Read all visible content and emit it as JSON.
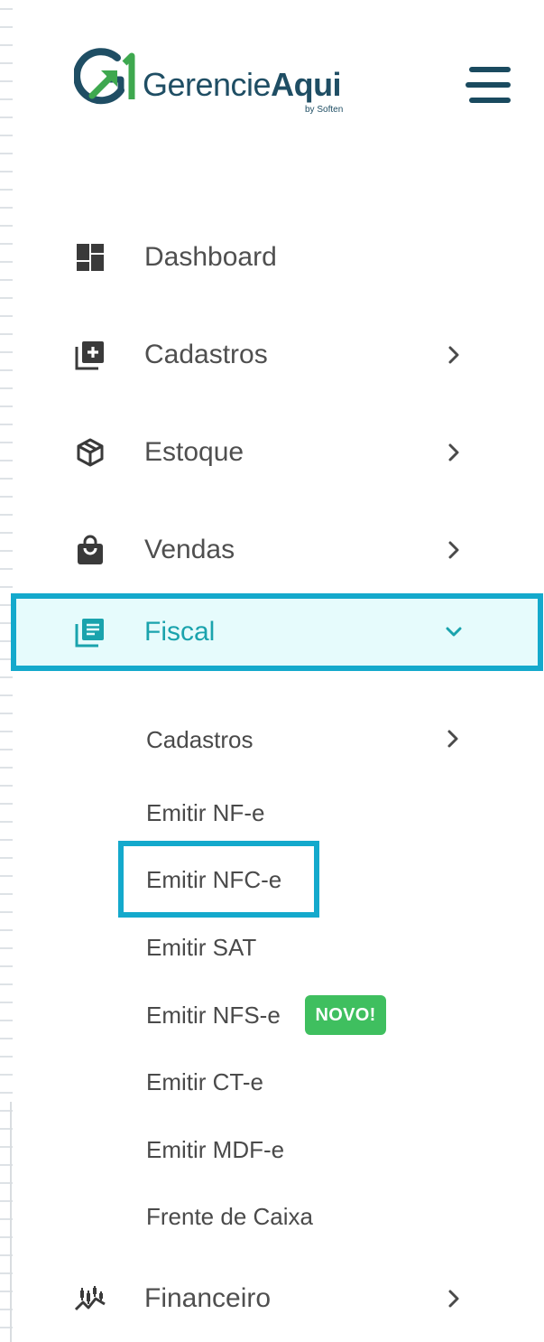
{
  "header": {
    "brand_regular": "Gerencie",
    "brand_bold": "Aqui",
    "brand_tagline": "by Soften",
    "logo_mark_icon": "g1-logo-icon",
    "menu_icon": "hamburger-icon"
  },
  "colors": {
    "brand_navy": "#1f4e64",
    "brand_green": "#3ea84f",
    "accent_teal": "#1aa3ad",
    "highlight_border": "#14a9cc",
    "active_bg": "#e6fbfc",
    "badge_green": "#3fbf5f",
    "text_gray": "#4f4f4f"
  },
  "nav": {
    "items": [
      {
        "label": "Dashboard",
        "icon": "dashboard-icon",
        "has_chevron": false
      },
      {
        "label": "Cadastros",
        "icon": "add-box-icon",
        "has_chevron": true
      },
      {
        "label": "Estoque",
        "icon": "package-icon",
        "has_chevron": true
      },
      {
        "label": "Vendas",
        "icon": "shopping-bag-icon",
        "has_chevron": true
      },
      {
        "label": "Fiscal",
        "icon": "library-books-icon",
        "has_chevron": true,
        "expanded": true
      },
      {
        "label": "Financeiro",
        "icon": "candlestick-chart-icon",
        "has_chevron": true
      }
    ]
  },
  "fiscal_submenu": {
    "items": [
      {
        "label": "Cadastros",
        "has_chevron": true
      },
      {
        "label": "Emitir NF-e"
      },
      {
        "label": "Emitir NFC-e",
        "highlighted": true
      },
      {
        "label": "Emitir SAT"
      },
      {
        "label": "Emitir NFS-e",
        "badge": "NOVO!"
      },
      {
        "label": "Emitir CT-e"
      },
      {
        "label": "Emitir MDF-e"
      },
      {
        "label": "Frente de Caixa"
      }
    ]
  }
}
